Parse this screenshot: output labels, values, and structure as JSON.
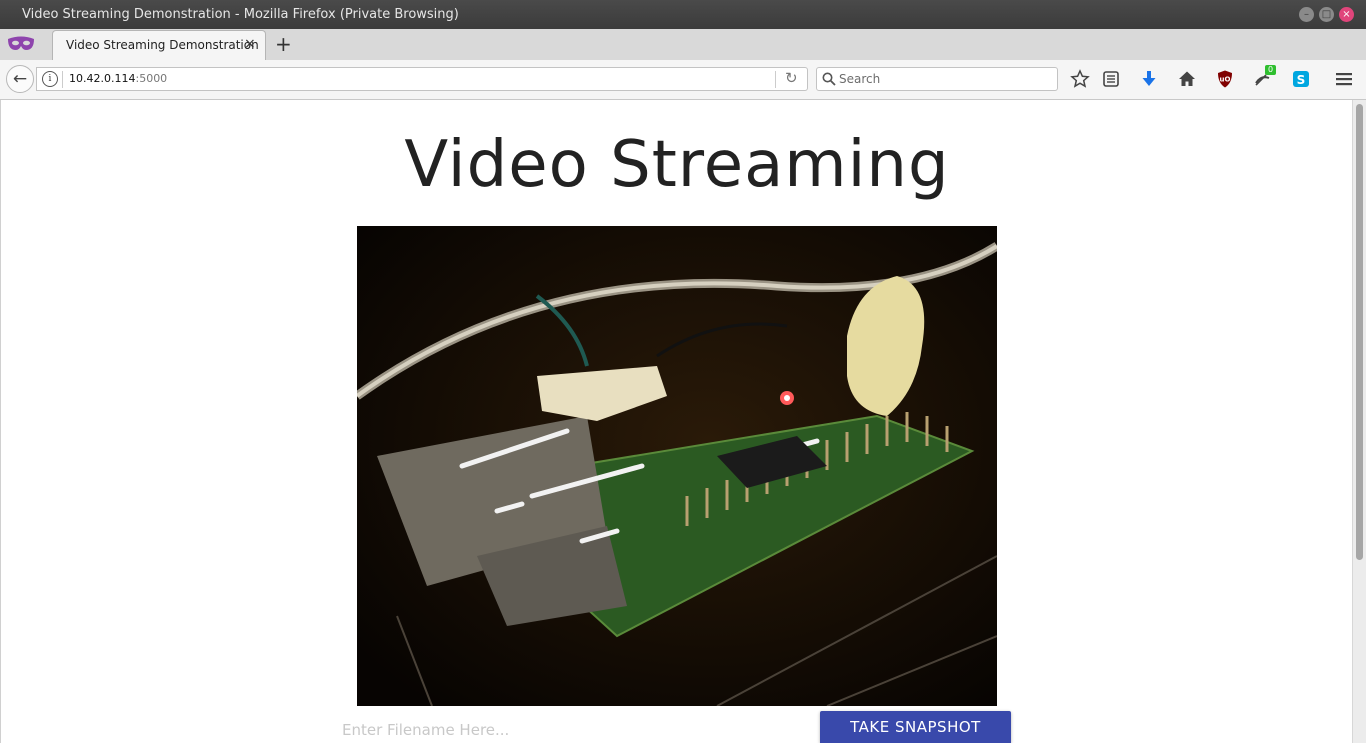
{
  "window": {
    "title": "Video Streaming Demonstration - Mozilla Firefox (Private Browsing)",
    "controls": {
      "minimize": "–",
      "maximize": "□",
      "close": "×"
    }
  },
  "tabs": [
    {
      "label": "Video Streaming Demonstration",
      "close": "×",
      "active": true
    }
  ],
  "new_tab": "+",
  "navbar": {
    "back": "←",
    "url_host": "10.42.0.114",
    "url_port": ":5000",
    "reload": "↻",
    "search_placeholder": "Search",
    "icons": [
      "bookmark-star-icon",
      "reading-list-icon",
      "download-icon",
      "home-icon",
      "ublock-icon",
      "extension-badge-icon",
      "skype-icon",
      "hamburger-menu-icon"
    ],
    "badge_count": "0"
  },
  "page": {
    "heading": "Video Streaming",
    "filename_placeholder": "Enter Filename Here...",
    "snapshot_button": "TAKE SNAPSHOT"
  },
  "colors": {
    "titlebar": "#3b3b3b",
    "private_mask": "#8e44ad",
    "download_arrow": "#1a73e8",
    "ublock": "#800000",
    "badge": "#2fbf2f",
    "skype": "#00a7e0",
    "snapshot_button": "#3949ab"
  }
}
